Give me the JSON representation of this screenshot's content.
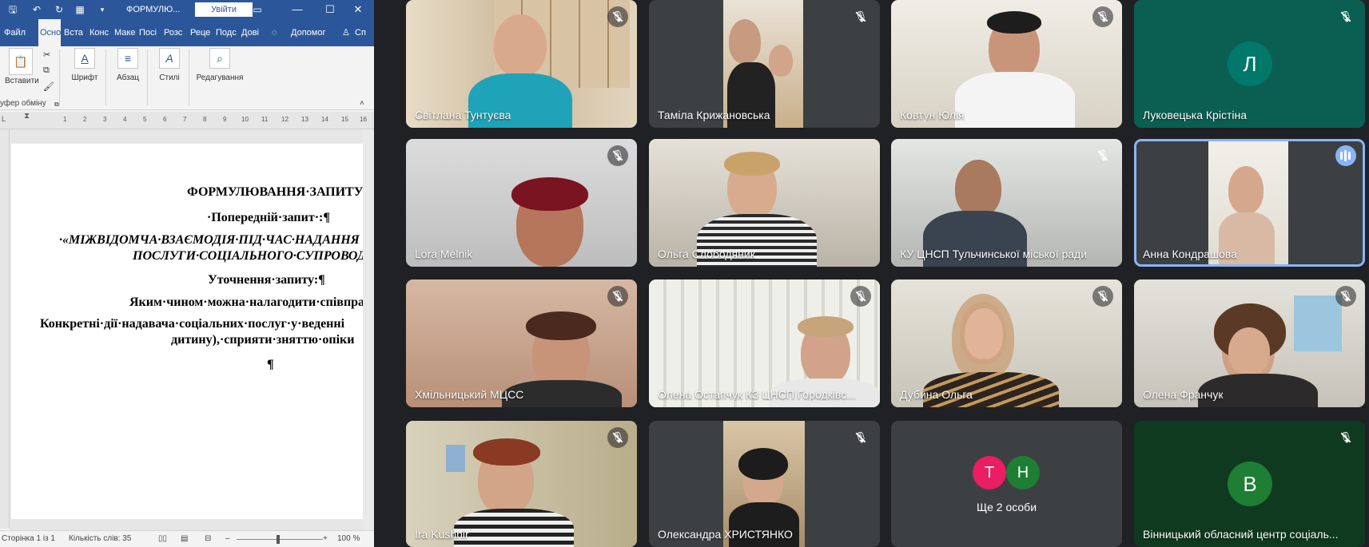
{
  "word": {
    "title": "ФОРМУЛЮ...",
    "signin_label": "Увійти",
    "tabs": [
      "Файл",
      "Осно",
      "Вста",
      "Конс",
      "Маке",
      "Посі",
      "Розс",
      "Реце",
      "Подс",
      "Дові"
    ],
    "tell_me": "Допомог",
    "ribbon": {
      "paste": "Вставити",
      "font": "Шрифт",
      "paragraph": "Абзац",
      "styles": "Стилі",
      "editing": "Редагування",
      "clipboard_caption": "уфер обміну"
    },
    "ruler_numbers": [
      "1",
      "2",
      "3",
      "4",
      "5",
      "6",
      "7",
      "8",
      "9",
      "10",
      "11",
      "12",
      "13",
      "14",
      "15",
      "16"
    ],
    "document": {
      "line1": "ФОРМУЛЮВАННЯ·ЗАПИТУ¶",
      "line2": "·Попередній·запит·:¶",
      "line3": "·«МІЖВІДОМЧА·ВЗАЄМОДІЯ·ПІД·ЧАС·НАДАННЯ",
      "line4": "ПОСЛУГИ·СОЦІАЛЬНОГО·СУПРОВОДУ",
      "line5": "Уточнення·запиту:¶",
      "line6": "Яким·чином·можна·налагодити·співпрацю",
      "line7": "Конкретні·дії·надавача·соціальних·послуг·у·веденні",
      "line8": "дитину),·сприяти·зняттю·опіки",
      "line9": "¶"
    },
    "status": {
      "page": "Сторінка 1 із 1",
      "words": "Кількість слів: 35",
      "zoom": "100 %"
    }
  },
  "meeting": {
    "participants": [
      {
        "name": "Світлана Тунтуєва",
        "muted": true
      },
      {
        "name": "Таміла Крижановська",
        "muted": true
      },
      {
        "name": "Ковтун Юлія",
        "muted": true
      },
      {
        "name": "Луковецька Крістіна",
        "muted": true,
        "initial": "Л"
      },
      {
        "name": "Lora Melnik",
        "muted": true
      },
      {
        "name": "Ольга Слободяник",
        "muted": false
      },
      {
        "name": "КУ ЦНСП Тульчинської міської ради",
        "muted": true
      },
      {
        "name": "Анна Кондрашова",
        "muted": false,
        "speaking": true
      },
      {
        "name": "Хмільницький МЦСС",
        "muted": true
      },
      {
        "name": "Олена Остапчук КЗ ЦНСП Городківс...",
        "muted": true
      },
      {
        "name": "Дубина Ольга",
        "muted": true
      },
      {
        "name": "Олена Франчук",
        "muted": true
      },
      {
        "name": "Ira Kushnir",
        "muted": true
      },
      {
        "name": "Олександра ХРИСТЯНКО",
        "muted": true
      },
      {
        "name": "Ще 2 особи",
        "initials": [
          "Т",
          "Н"
        ]
      },
      {
        "name": "Вінницький обласний центр соціаль...",
        "muted": true,
        "initial": "В"
      }
    ],
    "colors": {
      "background": "#202124",
      "tile": "#3c4043",
      "avatar_teal": "#00796b",
      "avatar_pink": "#e91e63",
      "avatar_green": "#1e7e34",
      "speaking": "#8ab4f8"
    }
  }
}
